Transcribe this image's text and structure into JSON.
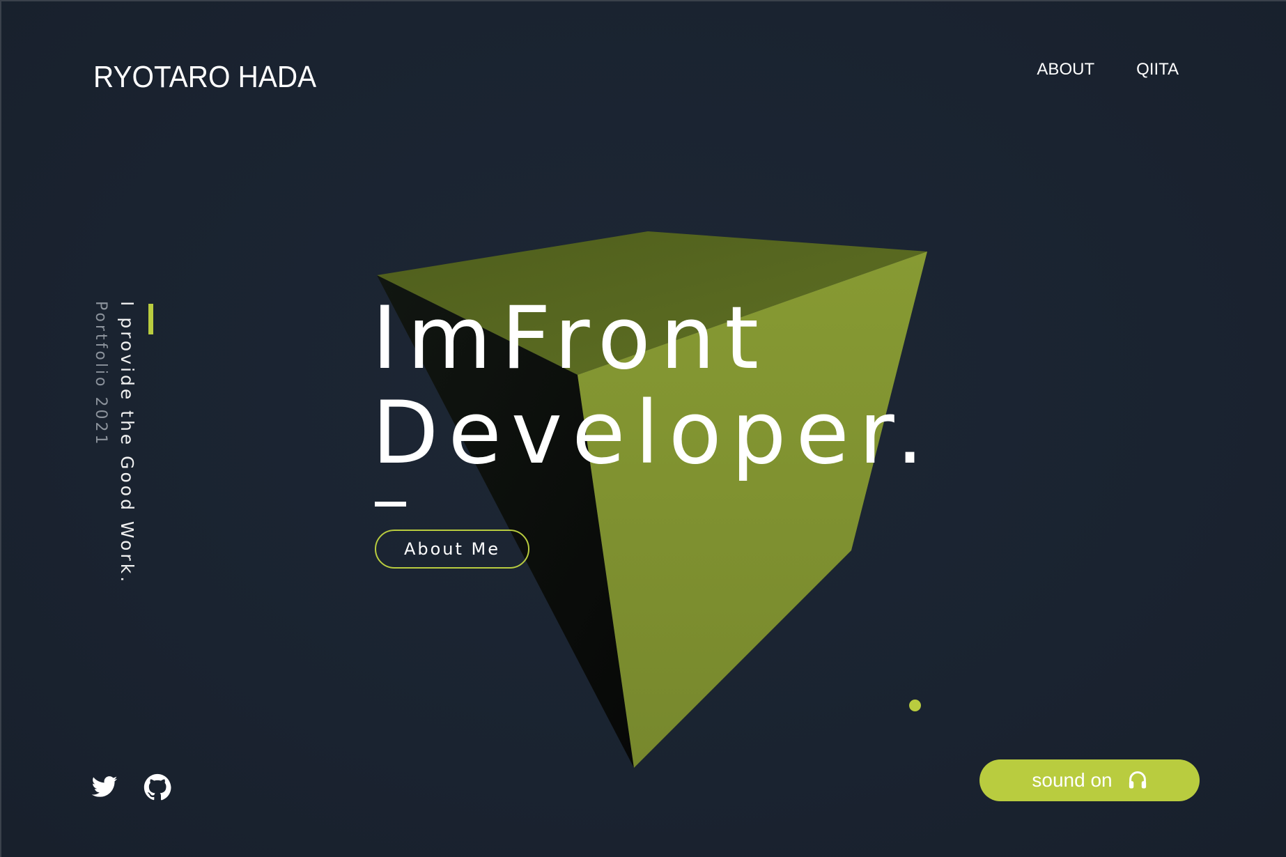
{
  "header": {
    "logo": "RYOTARO HADA",
    "nav": [
      {
        "label": "ABOUT"
      },
      {
        "label": "QIITA"
      }
    ]
  },
  "sidebar": {
    "tagline": "I provide the Good Work.",
    "subtitle": "Portfolio 2021"
  },
  "hero": {
    "title_line1": "ImFront",
    "title_line2": "Developer.",
    "cta_label": "About Me"
  },
  "social": [
    {
      "icon": "twitter-icon"
    },
    {
      "icon": "github-icon"
    }
  ],
  "sound": {
    "label": "sound on",
    "icon": "headphones-icon"
  },
  "colors": {
    "background": "#1b2431",
    "accent": "#b9cc3f",
    "cube_light": "#7f9230",
    "cube_top": "#56661f",
    "cube_dark": "#0b0d0b",
    "text": "#ffffff",
    "muted_text": "#8c939c"
  }
}
